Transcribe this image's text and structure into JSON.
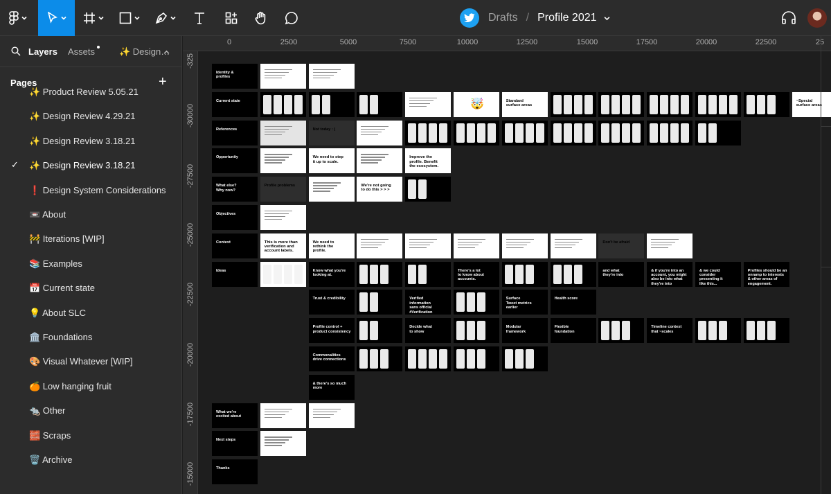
{
  "toolbar": {
    "tools": [
      {
        "name": "main-menu-tool",
        "icon": "figma-logo-icon",
        "has_menu": true
      },
      {
        "name": "move-tool",
        "icon": "cursor-arrow-icon",
        "has_menu": true,
        "active": true
      },
      {
        "name": "frame-tool",
        "icon": "hash-frame-icon",
        "has_menu": true
      },
      {
        "name": "shape-tool",
        "icon": "rectangle-icon",
        "has_menu": true
      },
      {
        "name": "pen-tool",
        "icon": "pen-icon",
        "has_menu": true
      },
      {
        "name": "text-tool",
        "icon": "text-t-icon",
        "has_menu": false
      },
      {
        "name": "resources-tool",
        "icon": "resources-icon",
        "has_menu": false
      },
      {
        "name": "hand-tool",
        "icon": "hand-icon",
        "has_menu": false
      },
      {
        "name": "comment-tool",
        "icon": "speech-bubble-icon",
        "has_menu": false
      }
    ],
    "active_color": "#0c8ce9",
    "breadcrumb": {
      "team_icon": "twitter-bird-icon",
      "folder": "Drafts",
      "separator": "/",
      "file": "Profile 2021"
    },
    "right": {
      "audio_icon": "headphones-icon",
      "avatar": "user-avatar"
    }
  },
  "left_panel": {
    "tabs": [
      {
        "label": "Layers",
        "active": true
      },
      {
        "label": "Assets",
        "has_dot": true
      },
      {
        "label": "✨ Design…"
      }
    ],
    "pages_title": "Pages",
    "add_page_icon": "plus-icon",
    "pages": [
      {
        "label": "✨ Product Review 5.05.21"
      },
      {
        "label": "✨ Design Review 4.29.21"
      },
      {
        "label": "✨ Design Review 3.18.21"
      },
      {
        "label": "✨ Design Review 3.18.21",
        "current": true
      },
      {
        "label": "❗ Design System Considerations"
      },
      {
        "label": "📼  About"
      },
      {
        "label": "🚧 Iterations [WIP]"
      },
      {
        "label": "📚 Examples"
      },
      {
        "label": "📅  Current state"
      },
      {
        "label": "💡 About SLC"
      },
      {
        "label": "🏛️ Foundations"
      },
      {
        "label": "🎨 Visual Whatever [WIP]"
      },
      {
        "label": "🍊 Low hanging fruit"
      },
      {
        "label": "🐀 Other"
      },
      {
        "label": "🧱 Scraps"
      },
      {
        "label": "🗑️ Archive"
      }
    ]
  },
  "rulers": {
    "horizontal": [
      "0",
      "2500",
      "5000",
      "7500",
      "10000",
      "12500",
      "15000",
      "17500",
      "20000",
      "22500",
      "25"
    ],
    "vertical": [
      "-325",
      "-30000",
      "-27500",
      "-25000",
      "-22500",
      "-20000",
      "-17500",
      "-15000"
    ]
  },
  "canvas": {
    "rows": [
      {
        "label": "Identity &\nprofiles",
        "frames": [
          {
            "kind": "w",
            "style": "text"
          },
          {
            "kind": "w",
            "style": "text"
          }
        ]
      },
      {
        "label": "Current state",
        "frames": [
          {
            "kind": "b",
            "style": "phones",
            "n": 4
          },
          {
            "kind": "b",
            "style": "phones",
            "n": 2
          },
          {
            "kind": "b",
            "style": "phones",
            "n": 2
          },
          {
            "kind": "w",
            "style": "text"
          },
          {
            "kind": "w",
            "style": "emoji",
            "text": "🤯"
          },
          {
            "kind": "w",
            "style": "big",
            "text": "Standard\nsurface areas"
          },
          {
            "kind": "b",
            "style": "phones",
            "n": 4
          },
          {
            "kind": "b",
            "style": "phones",
            "n": 4
          },
          {
            "kind": "b",
            "style": "phones",
            "n": 4
          },
          {
            "kind": "b",
            "style": "phones",
            "n": 4
          },
          {
            "kind": "b",
            "style": "phones",
            "n": 3
          },
          {
            "kind": "w",
            "style": "big",
            "text": "~Special\nsurface areas"
          },
          {
            "kind": "b",
            "style": "phones",
            "n": 3
          }
        ]
      },
      {
        "label": "References",
        "frames": [
          {
            "kind": "l",
            "style": "text"
          },
          {
            "kind": "g",
            "style": "label",
            "text": "Not today : ("
          },
          {
            "kind": "w",
            "style": "text"
          },
          {
            "kind": "b",
            "style": "phones",
            "n": 4
          },
          {
            "kind": "b",
            "style": "phones",
            "n": 4
          },
          {
            "kind": "b",
            "style": "phones",
            "n": 4
          },
          {
            "kind": "b",
            "style": "phones",
            "n": 4
          },
          {
            "kind": "b",
            "style": "phones",
            "n": 4
          },
          {
            "kind": "b",
            "style": "phones",
            "n": 4
          },
          {
            "kind": "b",
            "style": "phones",
            "n": 2
          }
        ]
      },
      {
        "label": "Opportunity",
        "frames": [
          {
            "kind": "w",
            "style": "text"
          },
          {
            "kind": "w",
            "style": "big",
            "text": "We need to step\nit up to scale."
          },
          {
            "kind": "w",
            "style": "text"
          },
          {
            "kind": "w",
            "style": "big",
            "text": "Improve the\nprofile. Benefit\nthe ecosystem."
          }
        ]
      },
      {
        "label": "What else?\nWhy now?",
        "frames": [
          {
            "kind": "g",
            "style": "label",
            "text": "Profile problems"
          },
          {
            "kind": "w",
            "style": "text"
          },
          {
            "kind": "w",
            "style": "big",
            "text": "We're not going\nto do this > > >"
          },
          {
            "kind": "b",
            "style": "phones",
            "n": 2
          }
        ]
      },
      {
        "label": "Objectives",
        "frames": [
          {
            "kind": "w",
            "style": "text"
          }
        ]
      },
      {
        "label": "Context",
        "frames": [
          {
            "kind": "w",
            "style": "big",
            "text": "This is more than\nverification and\naccount labels."
          },
          {
            "kind": "w",
            "style": "big",
            "text": "We need to\nrethink the\nprofile."
          },
          {
            "kind": "w",
            "style": "text"
          },
          {
            "kind": "w",
            "style": "text"
          },
          {
            "kind": "w",
            "style": "text"
          },
          {
            "kind": "w",
            "style": "text"
          },
          {
            "kind": "w",
            "style": "text"
          },
          {
            "kind": "g",
            "style": "label",
            "text": "Don't be afraid"
          },
          {
            "kind": "w",
            "style": "text"
          }
        ]
      },
      {
        "label": "Ideas",
        "frames": [
          {
            "kind": "w",
            "style": "phones",
            "n": 4
          },
          {
            "kind": "b",
            "style": "label",
            "text": "Know what you're\nlooking at."
          },
          {
            "kind": "b",
            "style": "phones",
            "n": 3
          },
          {
            "kind": "b",
            "style": "phones",
            "n": 2
          },
          {
            "kind": "b",
            "style": "label",
            "text": "There's a lot\nto know about\naccounts."
          },
          {
            "kind": "b",
            "style": "phones",
            "n": 3
          },
          {
            "kind": "b",
            "style": "phones",
            "n": 3
          },
          {
            "kind": "b",
            "style": "label",
            "text": "and what\nthey're into"
          },
          {
            "kind": "b",
            "style": "label",
            "text": "& if you're into an\naccount, you might\nalso be into what\nthey're into"
          },
          {
            "kind": "b",
            "style": "label",
            "text": "& we could\nconsider\npresenting it\nlike this..."
          },
          {
            "kind": "b",
            "style": "label",
            "text": "Profiles should be an\nonramp to interests\n& other areas of\nengagement."
          }
        ]
      },
      {
        "label": "",
        "frames": [
          {
            "kind": "b",
            "style": "label",
            "text": "Trust & credibility"
          },
          {
            "kind": "b",
            "style": "phones",
            "n": 2
          },
          {
            "kind": "b",
            "style": "label",
            "text": "Verified\ninformation\nsans official\n#Verification"
          },
          {
            "kind": "b",
            "style": "phones",
            "n": 3
          },
          {
            "kind": "b",
            "style": "label",
            "text": "Surface\nTweet metrics\nearlier"
          },
          {
            "kind": "b",
            "style": "label",
            "text": "Health score"
          }
        ]
      },
      {
        "label": "",
        "frames": [
          {
            "kind": "b",
            "style": "label",
            "text": "Profile control +\nproduct consistency"
          },
          {
            "kind": "b",
            "style": "phones",
            "n": 2
          },
          {
            "kind": "b",
            "style": "label",
            "text": "Decide what\nto show"
          },
          {
            "kind": "b",
            "style": "phones",
            "n": 3
          },
          {
            "kind": "b",
            "style": "label",
            "text": "Modular\nframework"
          },
          {
            "kind": "b",
            "style": "label",
            "text": "Flexible\nfoundation"
          },
          {
            "kind": "b",
            "style": "phones",
            "n": 3
          },
          {
            "kind": "b",
            "style": "label",
            "text": "Timeline context\nthat ~scales"
          },
          {
            "kind": "b",
            "style": "phones",
            "n": 3
          },
          {
            "kind": "b",
            "style": "phones",
            "n": 3
          }
        ]
      },
      {
        "label": "",
        "frames": [
          {
            "kind": "b",
            "style": "label",
            "text": "Commonalities\ndrive connections"
          },
          {
            "kind": "b",
            "style": "phones",
            "n": 3
          },
          {
            "kind": "b",
            "style": "phones",
            "n": 4
          },
          {
            "kind": "b",
            "style": "phones",
            "n": 3
          },
          {
            "kind": "b",
            "style": "phones",
            "n": 3
          }
        ]
      },
      {
        "label": "",
        "frames": [
          {
            "kind": "b",
            "style": "label",
            "text": "& there's so much more"
          }
        ]
      },
      {
        "label": "What we're\nexcited about",
        "frames": [
          {
            "kind": "w",
            "style": "text"
          },
          {
            "kind": "w",
            "style": "text"
          }
        ]
      },
      {
        "label": "Next steps",
        "frames": [
          {
            "kind": "w",
            "style": "text"
          }
        ]
      },
      {
        "label": "Thanks",
        "frames": []
      }
    ]
  }
}
